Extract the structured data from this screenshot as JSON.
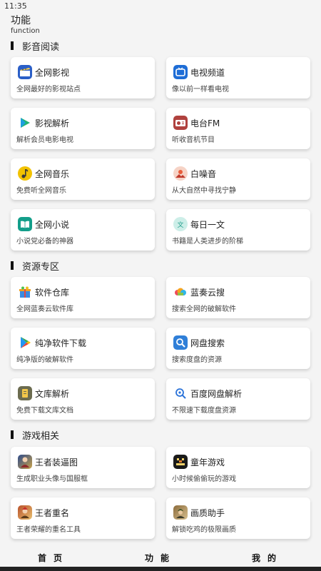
{
  "status_bar": {
    "time": "11:35"
  },
  "header": {
    "title": "功能",
    "subtitle": "function"
  },
  "sections": [
    {
      "title": "影音阅读",
      "items": [
        {
          "title": "全网影视",
          "desc": "全网最好的影视站点",
          "icon": "clapperboard-icon",
          "color": "#2b5fc7"
        },
        {
          "title": "电视频道",
          "desc": "像以前一样看电视",
          "icon": "tv-icon",
          "color": "#1e6dd6"
        },
        {
          "title": "影视解析",
          "desc": "解析会员电影电视",
          "icon": "play-icon",
          "color": "#22b573"
        },
        {
          "title": "电台FM",
          "desc": "听收音机节目",
          "icon": "radio-icon",
          "color": "#b0413e"
        },
        {
          "title": "全网音乐",
          "desc": "免费听全网音乐",
          "icon": "music-note-icon",
          "color": "#f2c200"
        },
        {
          "title": "白噪音",
          "desc": "从大自然中寻找宁静",
          "icon": "noise-icon",
          "color": "#e85d3a"
        },
        {
          "title": "全网小说",
          "desc": "小说党必备的神器",
          "icon": "book-icon",
          "color": "#139e8a"
        },
        {
          "title": "每日一文",
          "desc": "书籍是人类进步的阶梯",
          "icon": "article-icon",
          "color": "#26b5a0"
        }
      ]
    },
    {
      "title": "资源专区",
      "items": [
        {
          "title": "软件仓库",
          "desc": "全网蓝奏云软件库",
          "icon": "gift-box-icon",
          "color": "#f0a020"
        },
        {
          "title": "蓝奏云搜",
          "desc": "搜索全网的破解软件",
          "icon": "cloud-icon",
          "color": "#f4f4f4"
        },
        {
          "title": "纯净软件下载",
          "desc": "纯净版的破解软件",
          "icon": "store-play-icon",
          "color": "#34a853"
        },
        {
          "title": "网盘搜索",
          "desc": "搜索度盘的资源",
          "icon": "magnifier-icon",
          "color": "#2f7fd8"
        },
        {
          "title": "文库解析",
          "desc": "免费下载文库文档",
          "icon": "document-icon",
          "color": "#6b6b4f"
        },
        {
          "title": "百度网盘解析",
          "desc": "不限速下载度盘资源",
          "icon": "search-link-icon",
          "color": "#2b73d9"
        }
      ]
    },
    {
      "title": "游戏相关",
      "items": [
        {
          "title": "王者装逼图",
          "desc": "生成职业头像与国服框",
          "icon": "hero-portrait-icon",
          "color": "#2d4a8a"
        },
        {
          "title": "童年游戏",
          "desc": "小时候偷偷玩的游戏",
          "icon": "retro-game-icon",
          "color": "#1a1a1a"
        },
        {
          "title": "王者重名",
          "desc": "王者荣耀的重名工具",
          "icon": "warrior-portrait-icon",
          "color": "#b8502a"
        },
        {
          "title": "画质助手",
          "desc": "解锁吃鸡的极限画质",
          "icon": "soldier-portrait-icon",
          "color": "#8a6a3a"
        }
      ]
    }
  ],
  "bottom_nav": {
    "home": "首页",
    "functions": "功能",
    "mine": "我的"
  }
}
